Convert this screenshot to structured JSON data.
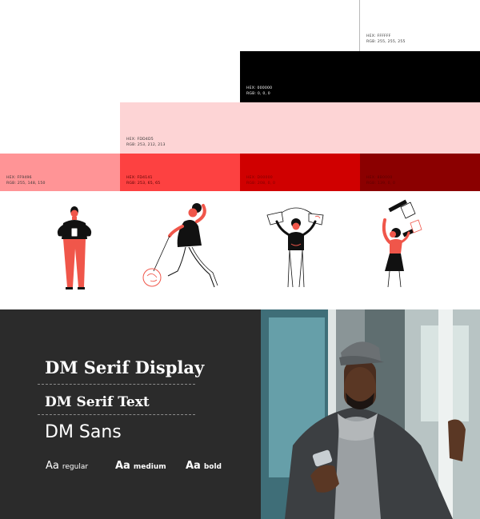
{
  "palette": [
    {
      "id": "white",
      "hex": "HEX: FFFFFF",
      "rgb": "RGB: 255, 255, 255",
      "color": "#FFFFFF",
      "text_color": "#333333"
    },
    {
      "id": "black",
      "hex": "HEX: 000000",
      "rgb": "RGB: 0, 0, 0",
      "color": "#000000",
      "text_color": "#ffffff"
    },
    {
      "id": "pale-pink",
      "hex": "HEX: FDD4D5",
      "rgb": "RGB: 253, 212, 213",
      "color": "#FDD4D5",
      "text_color": "#333333"
    },
    {
      "id": "salmon",
      "hex": "HEX: FF9496",
      "rgb": "RGB: 255, 148, 150",
      "color": "#FF9496",
      "text_color": "#333333"
    },
    {
      "id": "red",
      "hex": "HEX: FD4141",
      "rgb": "RGB: 253, 65, 65",
      "color": "#FD4141",
      "text_color": "#333333"
    },
    {
      "id": "crimson",
      "hex": "HEX: D00000",
      "rgb": "RGB: 208, 0, 0",
      "color": "#D00000",
      "text_color": "#7a0000"
    },
    {
      "id": "dark-red",
      "hex": "HEX: 8B0000",
      "rgb": "RGB: 139, 0, 0",
      "color": "#8B0000",
      "text_color": "#5a0000"
    }
  ],
  "accent_colors": {
    "coral": "#F0564A",
    "ink": "#111111",
    "panel": "#2B2B2B"
  },
  "typography": {
    "display": "DM Serif Display",
    "text": "DM Serif Text",
    "sans": "DM Sans",
    "weights": [
      {
        "aa": "Aa",
        "name": "regular"
      },
      {
        "aa": "Aa",
        "name": "medium"
      },
      {
        "aa": "Aa",
        "name": "bold"
      }
    ]
  },
  "illustrations": [
    {
      "name": "man-holding-phone-illustration"
    },
    {
      "name": "woman-running-with-balloon-illustration"
    },
    {
      "name": "woman-holding-banner-illustration"
    },
    {
      "name": "woman-holding-signs-illustration"
    }
  ]
}
